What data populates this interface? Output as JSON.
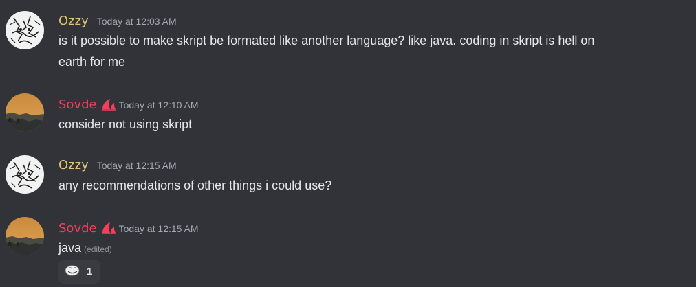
{
  "messages": [
    {
      "author": "Ozzy",
      "timestamp": "Today at 12:03 AM",
      "lines": [
        "is it possible to make skript be formated like another language? like java. coding in skript is hell on",
        "earth for me"
      ],
      "avatar_icon": "ozzy-sketch-avatar"
    },
    {
      "author": "Sovde",
      "timestamp": "Today at 12:10 AM",
      "lines": [
        "consider not using skript"
      ],
      "badge_icon": "pink-sail-badge",
      "avatar_icon": "sunset-landscape-avatar"
    },
    {
      "author": "Ozzy",
      "timestamp": "Today at 12:15 AM",
      "lines": [
        "any recommendations of other things i could use?"
      ],
      "avatar_icon": "ozzy-sketch-avatar"
    },
    {
      "author": "Sovde",
      "timestamp": "Today at 12:15 AM",
      "lines": [
        "java"
      ],
      "edited_label": "(edited)",
      "badge_icon": "pink-sail-badge",
      "avatar_icon": "sunset-landscape-avatar",
      "reaction": {
        "emoji_icon": "trollface-emoji-icon",
        "count": "1"
      }
    }
  ],
  "colors": {
    "background": "#313338",
    "ozzy_name": "#e3c378",
    "sovde_name": "#f23f5c",
    "text": "#e6e7ea",
    "timestamp": "#a4a8b0",
    "reaction_bg": "#393b41"
  }
}
